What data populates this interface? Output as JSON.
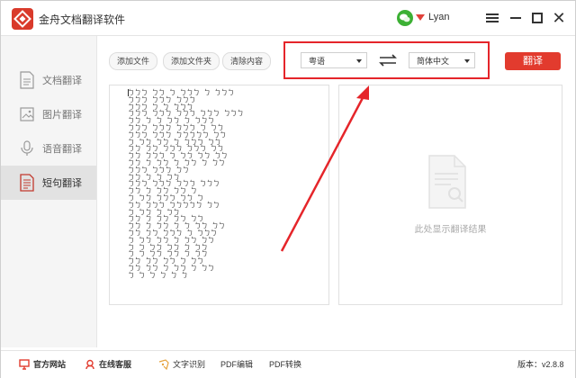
{
  "app": {
    "title": "金舟文档翻译软件",
    "user": "Lyan"
  },
  "sidebar": {
    "items": [
      {
        "label": "文档翻译",
        "icon": "document-icon"
      },
      {
        "label": "图片翻译",
        "icon": "image-icon"
      },
      {
        "label": "语音翻译",
        "icon": "microphone-icon"
      },
      {
        "label": "短句翻译",
        "icon": "text-document-icon"
      }
    ],
    "active": "短句翻译"
  },
  "toolbar": {
    "add_file": "添加文件",
    "add_folder": "添加文件夹",
    "clear": "清除内容"
  },
  "lang": {
    "source": "粤语",
    "target": "简体中文"
  },
  "translate_btn": "翻译",
  "source_text": "ㄅㄅㄅ ㄅㄅ ㄅ ㄅㄅㄅ ㄅ ㄅㄅㄅ\nㄅㄅㄅ ㄅㄅㄅ ㄅㄅㄅ\nㄅㄅㄅ ㄅ ㄅ ㄅㄅㄅ\nㄅㄅㄅ ㄅㄅㄅ ㄅㄅㄅ ㄅㄅㄅ ㄅㄅㄅ\nㄅㄅ ㄅ ㄅ ㄅㄅ ㄅ ㄅㄅㄅ\nㄅㄅㄅ ㄅㄅㄅ ㄅㄅㄅ ㄅ ㄅㄅ\nㄅㄅㄅ ㄅㄅㄅ ㄅㄅㄅㄅㄅ ㄅㄅ\nㄅ ㄅㄅ ㄅㄅ ㄅ ㄅㄅㄅ ㄅㄅ\nㄅㄅ ㄅㄅ ㄅㄅㄅ ㄅㄅㄅ ㄅㄅ\nㄅㄅ ㄅㄅㄅ ㄅ ㄅㄅ ㄅㄅ ㄅㄅ\nㄅㄅ ㄅ ㄅㄅ ㄅ ㄅㄅ ㄅ ㄅㄅ\nㄅㄅㄅ ㄅㄅㄅ ㄅㄅ\nㄅㄅ ㄅ ㄅ ㄅㄅ\nㄅㄅㄅ ㄅㄅㄅ ㄅㄅㄅ ㄅㄅㄅ\nㄅㄅ ㄅ ㄅㄅ ㄅㄅ ㄅ\nㄅ ㄅㄅ ㄅㄅㄅ ㄅㄅ ㄅ\nㄅㄅ ㄅㄅㄅ ㄅㄅㄅㄅㄅ ㄅㄅ\nㄅ ㄅㄅ ㄅ ㄅㄅ\nㄅㄅ ㄅ ㄅㄅ ㄅㄅ ㄅㄅ\nㄅㄅ ㄅ ㄅㄅ ㄅ ㄅ ㄅㄅ ㄅㄅ\nㄅㄅ ㄅㄅ ㄅㄅㄅ ㄅ ㄅㄅㄅ\nㄅ ㄅㄅ ㄅㄅ ㄅ ㄅㄅ ㄅㄅ\nㄅ ㄅ ㄅㄅ ㄅㄅ ㄅ ㄅㄅ\nㄅ ㄅ ㄅㄅ ㄅㄅ ㄅ ㄅㄅ\nㄅㄅ ㄅㄅ ㄅㄅ ㄅ ㄅㄅ\nㄅㄅ ㄅㄅ ㄅ ㄅㄅ ㄅ ㄅㄅ\nㄅ ㄅ ㄅ ㄅ ㄅ ㄅ",
  "result_placeholder": "此处显示翻译结果",
  "footer": {
    "website": "官方网站",
    "support": "在线客服",
    "ocr": "文字识别",
    "pdf_edit": "PDF编辑",
    "pdf_convert": "PDF转换",
    "version": "版本：v2.8.8"
  },
  "colors": {
    "accent": "#e23b2e",
    "highlight_box": "#e5252a"
  }
}
